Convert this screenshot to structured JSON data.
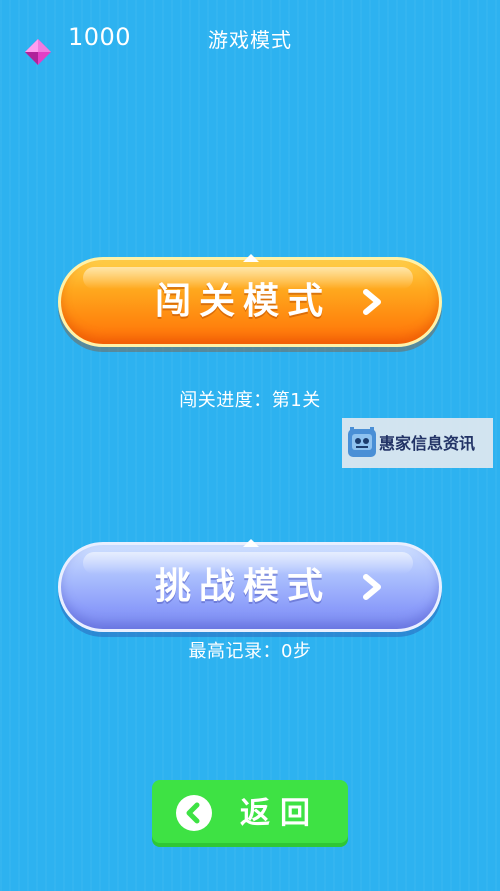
{
  "header": {
    "coins": "1000",
    "title": "游戏模式",
    "gem_icon": "pink-diamond-gem-icon"
  },
  "modes": {
    "level": {
      "label": "闯关模式",
      "arrow_icon": "chevron-right-icon",
      "progress_text": "闯关进度：第1关",
      "progress_level": 1
    },
    "challenge": {
      "label": "挑战模式",
      "arrow_icon": "chevron-right-icon",
      "record_text": "最高记录：0步",
      "best_steps": 0
    }
  },
  "watermark": {
    "text": "惠家信息资讯",
    "logo_icon": "robot-face-logo-icon"
  },
  "footer": {
    "back_label": "返回",
    "back_icon": "chevron-left-circle-icon"
  },
  "colors": {
    "background": "#2db2f0",
    "level_button": "#ff8a10",
    "challenge_button": "#8c9dfa",
    "back_button": "#3ee244",
    "gem": "#e040c8"
  }
}
